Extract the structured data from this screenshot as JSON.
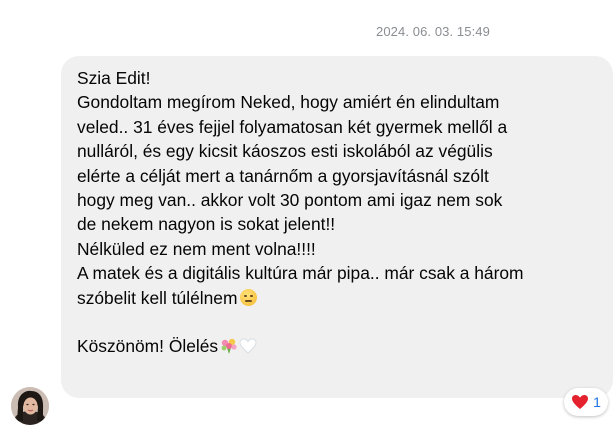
{
  "message": {
    "timestamp": "2024. 06. 03. 15:49",
    "lines": [
      "Szia Edit!",
      "Gondoltam megírom Neked, hogy amiért én elindultam",
      "veled.. 31 éves fejjel folyamatosan két gyermek mellől a",
      "nulláról, és egy kicsit káoszos esti iskolából az végülis",
      "elérte a célját mert a tanárnőm a gyorsjavításnál szólt",
      "hogy meg van.. akkor volt 30 pontom ami igaz nem sok",
      "de nekem nagyon is sokat jelent!!",
      "Nélküled ez nem ment volna!!!!",
      "A matek és a digitális kultúra már pipa.. már csak a három",
      "szóbelit kell túlélnem"
    ],
    "closing": "Köszönöm! Ölelés",
    "emojis": {
      "line10": "face-with-rolling-eyes-icon",
      "closing_1": "bouquet-icon",
      "closing_2": "white-heart-icon"
    }
  },
  "reaction": {
    "emoji": "heart-icon",
    "count": "1",
    "color": "#e4222e"
  },
  "colors": {
    "bubble_bg": "#f0f0f0",
    "timestamp": "#8a8d91",
    "text": "#050505",
    "count": "#1a73e8"
  }
}
